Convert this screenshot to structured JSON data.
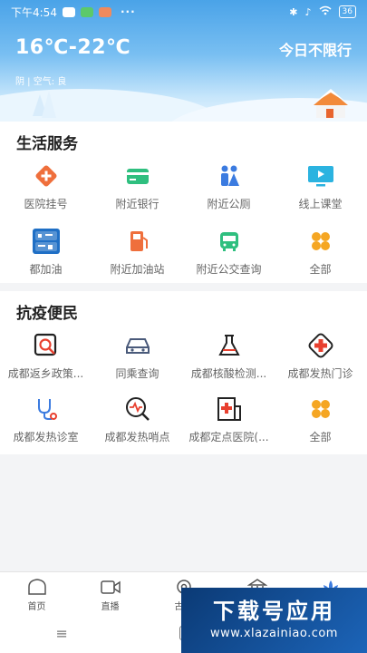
{
  "status": {
    "time": "下午4:54",
    "battery": "36"
  },
  "weather": {
    "temperature": "16℃-22℃",
    "condition": "阴 | 空气: 良",
    "traffic_limit": "今日不限行"
  },
  "life_services": {
    "title": "生活服务",
    "items": [
      {
        "label": "医院挂号",
        "icon": "hospital-icon"
      },
      {
        "label": "附近银行",
        "icon": "bank-card-icon"
      },
      {
        "label": "附近公厕",
        "icon": "restroom-icon"
      },
      {
        "label": "线上课堂",
        "icon": "online-class-icon"
      },
      {
        "label": "都加油",
        "icon": "dujiayou-logo-icon"
      },
      {
        "label": "附近加油站",
        "icon": "gas-station-icon"
      },
      {
        "label": "附近公交查询",
        "icon": "bus-icon"
      },
      {
        "label": "全部",
        "icon": "grid-all-icon"
      }
    ]
  },
  "epidemic_services": {
    "title": "抗疫便民",
    "items": [
      {
        "label": "成都返乡政策...",
        "icon": "policy-search-icon"
      },
      {
        "label": "同乘查询",
        "icon": "car-icon"
      },
      {
        "label": "成都核酸检测...",
        "icon": "flask-icon"
      },
      {
        "label": "成都发热门诊",
        "icon": "medical-cross-icon"
      },
      {
        "label": "成都发热诊室",
        "icon": "stethoscope-icon"
      },
      {
        "label": "成都发热哨点",
        "icon": "pulse-search-icon"
      },
      {
        "label": "成都定点医院(...",
        "icon": "hospital-building-icon"
      },
      {
        "label": "全部",
        "icon": "grid-all-icon"
      }
    ]
  },
  "tabbar": {
    "items": [
      {
        "label": "首页",
        "icon": "home-icon"
      },
      {
        "label": "直播",
        "icon": "video-icon"
      },
      {
        "label": "古蜀",
        "icon": "sun-bird-icon"
      },
      {
        "label": "",
        "icon": "museum-icon"
      },
      {
        "label": "",
        "icon": "lotus-icon"
      }
    ]
  },
  "watermark": {
    "title": "下载号应用",
    "url": "www.xlazainiao.com"
  },
  "colors": {
    "header_blue": "#4aa3e8",
    "orange": "#ef6f3c",
    "green": "#2fbf7f",
    "blue": "#3b7be0",
    "cyan": "#2bb3e0",
    "yellow": "#f5a623",
    "red": "#e8402f"
  }
}
